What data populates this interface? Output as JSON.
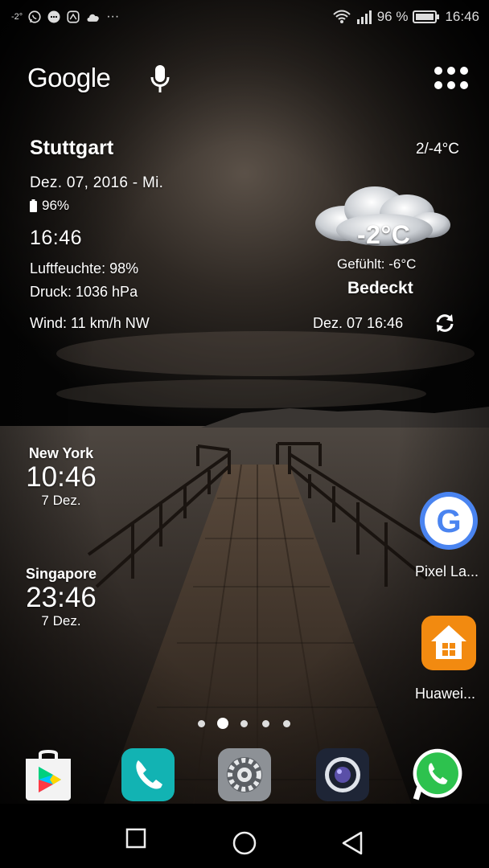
{
  "status_bar": {
    "temp": "-2°",
    "signal_percent": "96 %",
    "time": "16:46"
  },
  "google_bar": {
    "logo": "Google"
  },
  "weather": {
    "city": "Stuttgart",
    "high_low": "2/-4°C",
    "date": "Dez. 07, 2016 - Mi.",
    "battery": "96%",
    "clock": "16:46",
    "humidity": "Luftfeuchte: 98%",
    "pressure": "Druck: 1036 hPa",
    "wind": "Wind: 11 km/h NW",
    "temperature": "-2°C",
    "feels_like": "Gefühlt: -6°C",
    "condition": "Bedeckt",
    "updated": "Dez. 07  16:46"
  },
  "world_clocks": [
    {
      "city": "New York",
      "time": "10:46",
      "date": "7 Dez."
    },
    {
      "city": "Singapore",
      "time": "23:46",
      "date": "7 Dez."
    }
  ],
  "side_apps": [
    {
      "label": "Pixel La...",
      "icon": "pixel-launcher-icon",
      "color": "#4a84f0"
    },
    {
      "label": "Huawei...",
      "icon": "huawei-home-icon",
      "color": "#f28a10"
    }
  ],
  "page_indicator": {
    "count": 5,
    "active": 2
  },
  "dock": [
    {
      "name": "play-store",
      "icon": "play-store-icon"
    },
    {
      "name": "phone",
      "icon": "phone-icon",
      "color": "#12b3b3"
    },
    {
      "name": "settings",
      "icon": "settings-icon"
    },
    {
      "name": "camera",
      "icon": "camera-icon"
    },
    {
      "name": "whatsapp",
      "icon": "whatsapp-icon",
      "color": "#2dc24e"
    }
  ]
}
